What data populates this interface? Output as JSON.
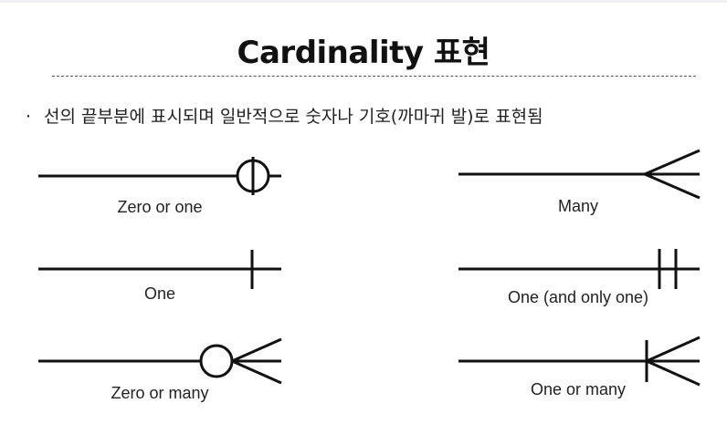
{
  "title": "Cardinality 표현",
  "bullet": {
    "marker": "·",
    "text": "선의 끝부분에 표시되며 일반적으로 숫자나 기호(까마귀 발)로 표현됨"
  },
  "symbols": {
    "zero_or_one": "Zero or one",
    "one": "One",
    "zero_or_many": "Zero or many",
    "many": "Many",
    "one_and_only_one": "One (and only one)",
    "one_or_many": "One or many"
  }
}
